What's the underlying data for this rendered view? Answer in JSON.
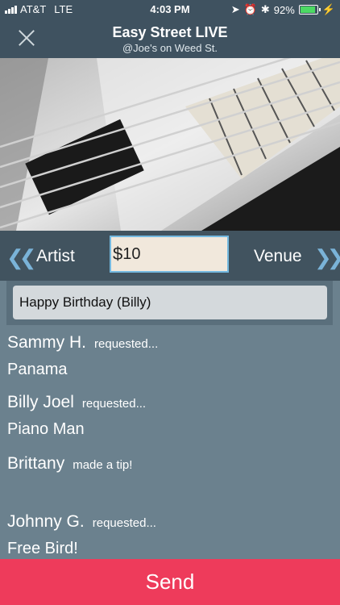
{
  "status_bar": {
    "carrier": "AT&T",
    "network": "LTE",
    "time": "4:03 PM",
    "battery": "92%"
  },
  "header": {
    "title": "Easy Street LIVE",
    "subtitle": "@Joe's on Weed St."
  },
  "tip": {
    "artist_label": "Artist",
    "venue_label": "Venue",
    "currency": "$",
    "amount": "10"
  },
  "message": {
    "value": "Happy Birthday (Billy)"
  },
  "feed": [
    {
      "name": "Sammy H.",
      "action": "requested...",
      "song": "Panama"
    },
    {
      "name": "Billy Joel",
      "action": "requested...",
      "song": "Piano Man"
    },
    {
      "name": "Brittany",
      "action": "made a tip!",
      "song": ""
    },
    {
      "name": "Johnny G.",
      "action": "requested...",
      "song": "Free Bird!"
    }
  ],
  "send_label": "Send",
  "colors": {
    "header": "#3f5260",
    "background": "#6b818e",
    "send": "#ee3b5b",
    "accent": "#74b9e0"
  }
}
